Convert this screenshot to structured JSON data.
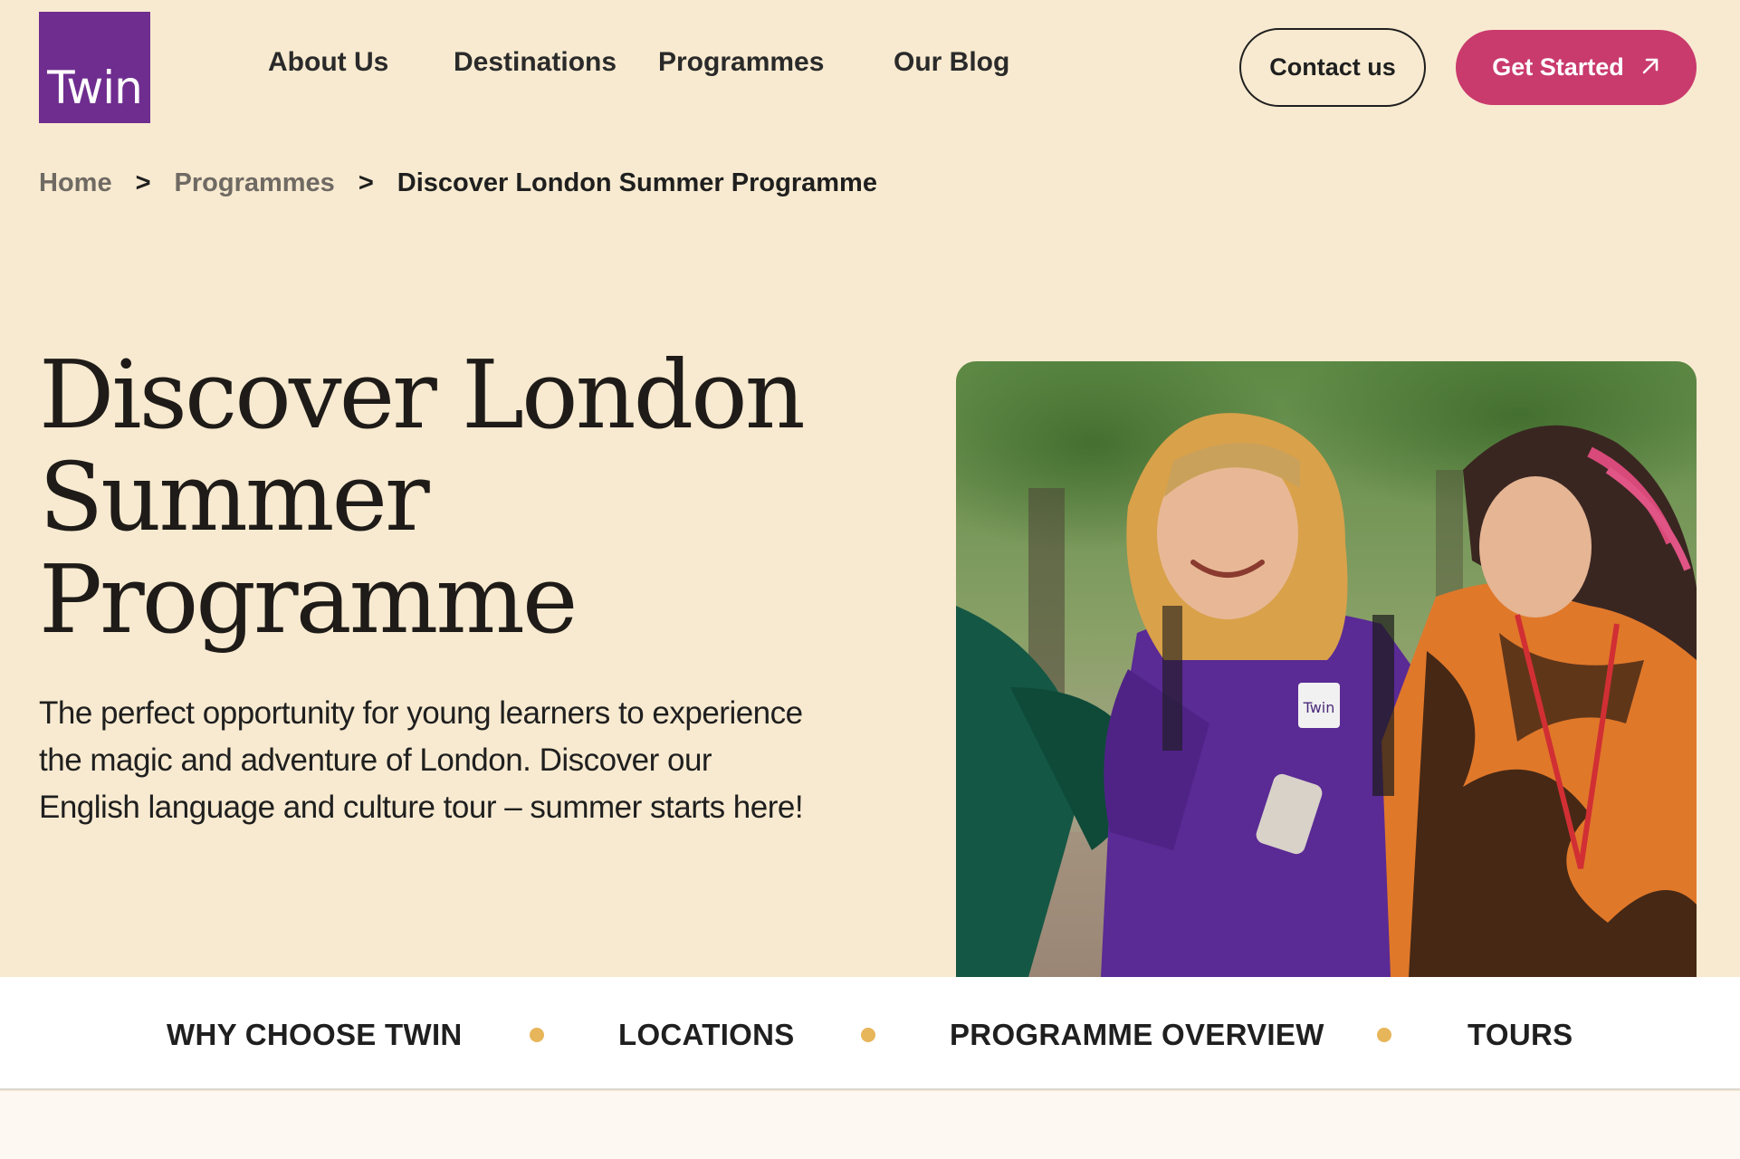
{
  "brand": {
    "logo_text": "Twin",
    "accent": "#c93a6d",
    "logo_color": "#6f2d8f",
    "background": "#f8ead0"
  },
  "nav": {
    "items": [
      "About Us",
      "Destinations",
      "Programmes",
      "Our Blog"
    ]
  },
  "header": {
    "contact_label": "Contact us",
    "start_label": "Get Started",
    "start_icon": "arrow-up-right-icon"
  },
  "breadcrumb": {
    "home": "Home",
    "separator": ">",
    "section": "Programmes",
    "current": "Discover London Summer Programme"
  },
  "hero": {
    "title_lines": [
      "Discover London",
      "Summer",
      "Programme"
    ],
    "description_lines": [
      "The perfect opportunity for young learners to experience",
      "the magic and adventure of London. Discover our",
      "English language and culture tour – summer starts here!"
    ],
    "image_badge_text": "Twin"
  },
  "section_nav": {
    "items": [
      "WHY CHOOSE TWIN",
      "LOCATIONS",
      "PROGRAMME OVERVIEW",
      "TOURS"
    ],
    "dot_color": "#e7b55a"
  }
}
